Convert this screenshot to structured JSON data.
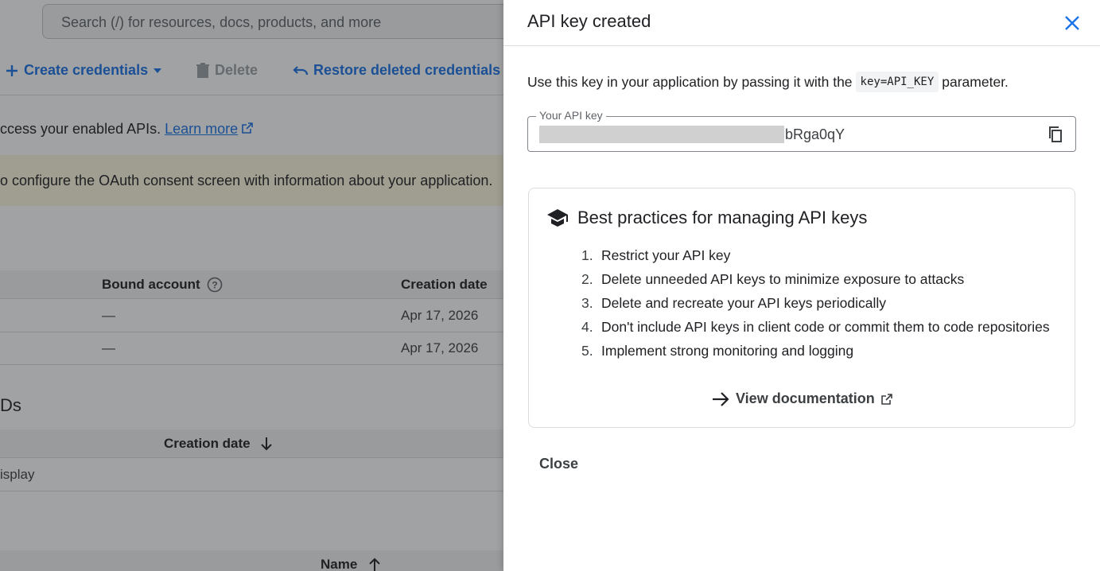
{
  "background": {
    "search_placeholder": "Search (/) for resources, docs, products, and more",
    "toolbar": {
      "create_label": "Create credentials",
      "delete_label": "Delete",
      "restore_label": "Restore deleted credentials"
    },
    "intro_text": "ccess your enabled APIs. ",
    "learn_more": "Learn more",
    "banner_text": "o configure the OAuth consent screen with information about your application.",
    "api_keys_table": {
      "headers": [
        "Bound account",
        "Creation date"
      ],
      "rows": [
        {
          "bound": "—",
          "date": "Apr 17, 2026"
        },
        {
          "bound": "—",
          "date": "Apr 17, 2026"
        }
      ]
    },
    "section_title": "Ds",
    "oauth_table": {
      "header": "Creation date",
      "row": "isplay"
    },
    "bottom_header": "Name"
  },
  "drawer": {
    "title": "API key created",
    "usage_prefix": "Use this key in your application by passing it with the",
    "usage_code": "key=API_KEY",
    "usage_suffix": "parameter.",
    "key_label": "Your API key",
    "key_visible_suffix": "bRga0qY",
    "card": {
      "title": "Best practices for managing API keys",
      "items": [
        {
          "num": "1.",
          "text": "Restrict your API key"
        },
        {
          "num": "2.",
          "text": "Delete unneeded API keys to minimize exposure to attacks"
        },
        {
          "num": "3.",
          "text": "Delete and recreate your API keys periodically"
        },
        {
          "num": "4.",
          "text": "Don't include API keys in client code or commit them to code repositories"
        },
        {
          "num": "5.",
          "text": "Implement strong monitoring and logging"
        }
      ],
      "doc_link": "View documentation"
    },
    "close_label": "Close"
  },
  "colors": {
    "accent": "#1a73e8",
    "banner": "#fef7e0",
    "scrim": "rgba(32,33,36,0.42)"
  }
}
